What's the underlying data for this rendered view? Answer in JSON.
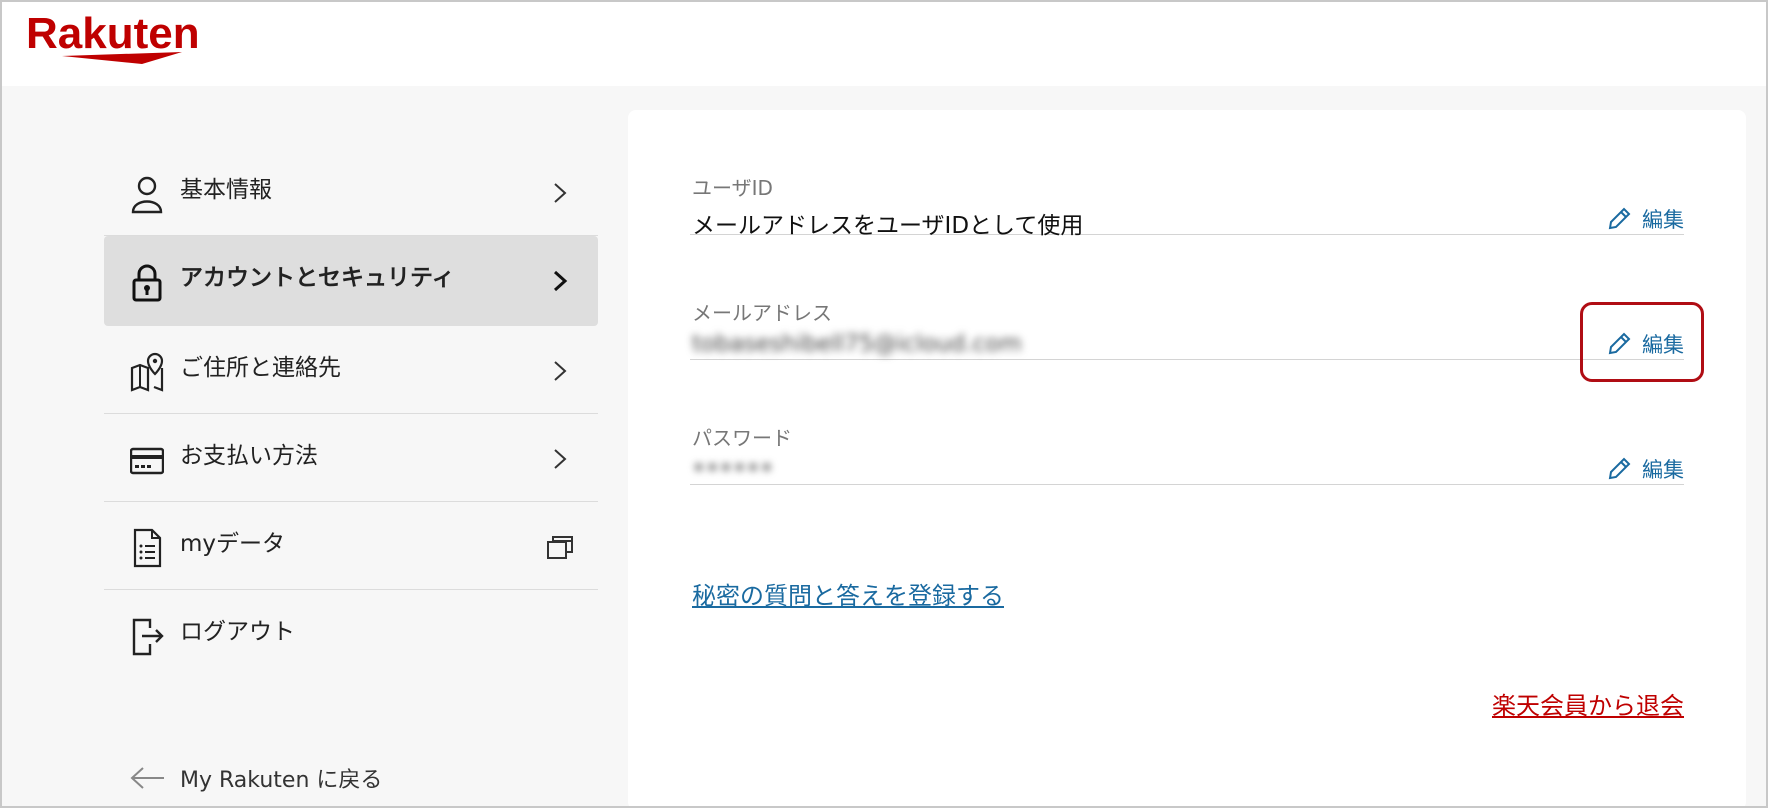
{
  "brand": {
    "logo_text": "Rakuten",
    "color": "#bf0000"
  },
  "sidebar": {
    "items": [
      {
        "label": "基本情報",
        "icon": "person-icon",
        "active": false
      },
      {
        "label": "アカウントとセキュリティ",
        "icon": "lock-icon",
        "active": true
      },
      {
        "label": "ご住所と連絡先",
        "icon": "map-pin-icon",
        "active": false
      },
      {
        "label": "お支払い方法",
        "icon": "credit-card-icon",
        "active": false
      },
      {
        "label": "myデータ",
        "icon": "document-icon",
        "active": false
      },
      {
        "label": "ログアウト",
        "icon": "logout-icon",
        "active": false
      }
    ],
    "back_label": "My Rakuten に戻る"
  },
  "account": {
    "userid": {
      "label": "ユーザID",
      "value": "メールアドレスをユーザIDとして使用",
      "edit_label": "編集"
    },
    "email": {
      "label": "メールアドレス",
      "value": "tobaseshibell75@icloud.com",
      "edit_label": "編集"
    },
    "password": {
      "label": "パスワード",
      "value": "••••••",
      "edit_label": "編集"
    },
    "secret_question_link": "秘密の質問と答えを登録する",
    "withdraw_link": "楽天会員から退会"
  },
  "colors": {
    "link_blue": "#1a6aa0",
    "accent_red": "#bf0000",
    "highlight_red": "#b00d14"
  }
}
